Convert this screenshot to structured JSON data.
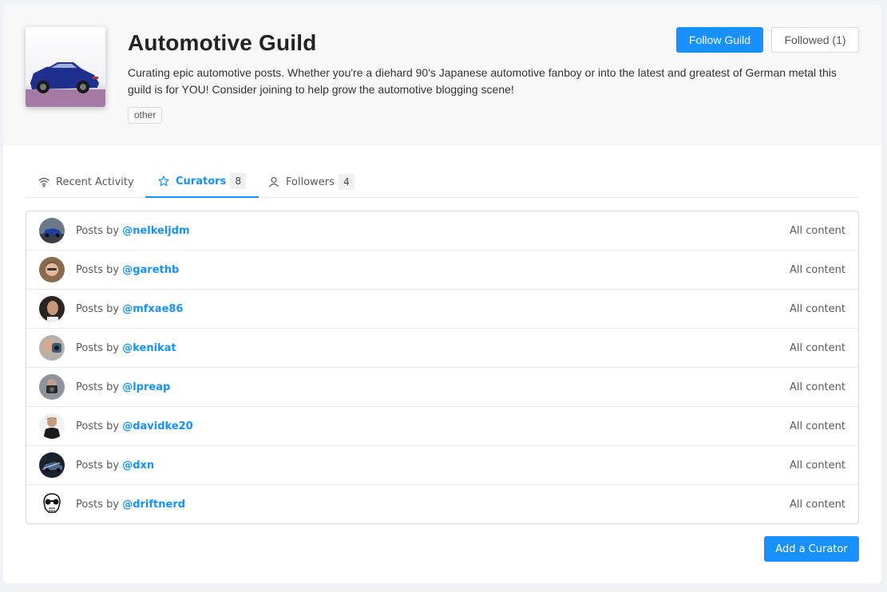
{
  "guild": {
    "title": "Automotive Guild",
    "description": "Curating epic automotive posts. Whether you're a diehard 90's Japanese automotive fanboy or into the latest and greatest of German metal this guild is for YOU! Consider joining to help grow the automotive blogging scene!",
    "tag": "other",
    "image_icon": "car-photo"
  },
  "actions": {
    "follow_label": "Follow Guild",
    "followed_label": "Followed (1)",
    "add_curator_label": "Add a Curator"
  },
  "tabs": [
    {
      "label": "Recent Activity",
      "icon": "wifi-icon"
    },
    {
      "label": "Curators",
      "icon": "star-icon",
      "count": "8"
    },
    {
      "label": "Followers",
      "icon": "user-icon",
      "count": "4"
    }
  ],
  "curators": {
    "prefix": "Posts by",
    "scope": "All content",
    "items": [
      {
        "handle": "@nelkeljdm",
        "avatar": "car"
      },
      {
        "handle": "@garethb",
        "avatar": "person"
      },
      {
        "handle": "@mfxae86",
        "avatar": "person"
      },
      {
        "handle": "@kenikat",
        "avatar": "person"
      },
      {
        "handle": "@lpreap",
        "avatar": "person"
      },
      {
        "handle": "@davidke20",
        "avatar": "person"
      },
      {
        "handle": "@dxn",
        "avatar": "car"
      },
      {
        "handle": "@driftnerd",
        "avatar": "skull"
      }
    ]
  },
  "colors": {
    "accent": "#1890ff",
    "header_bg": "#f8f8f9"
  }
}
